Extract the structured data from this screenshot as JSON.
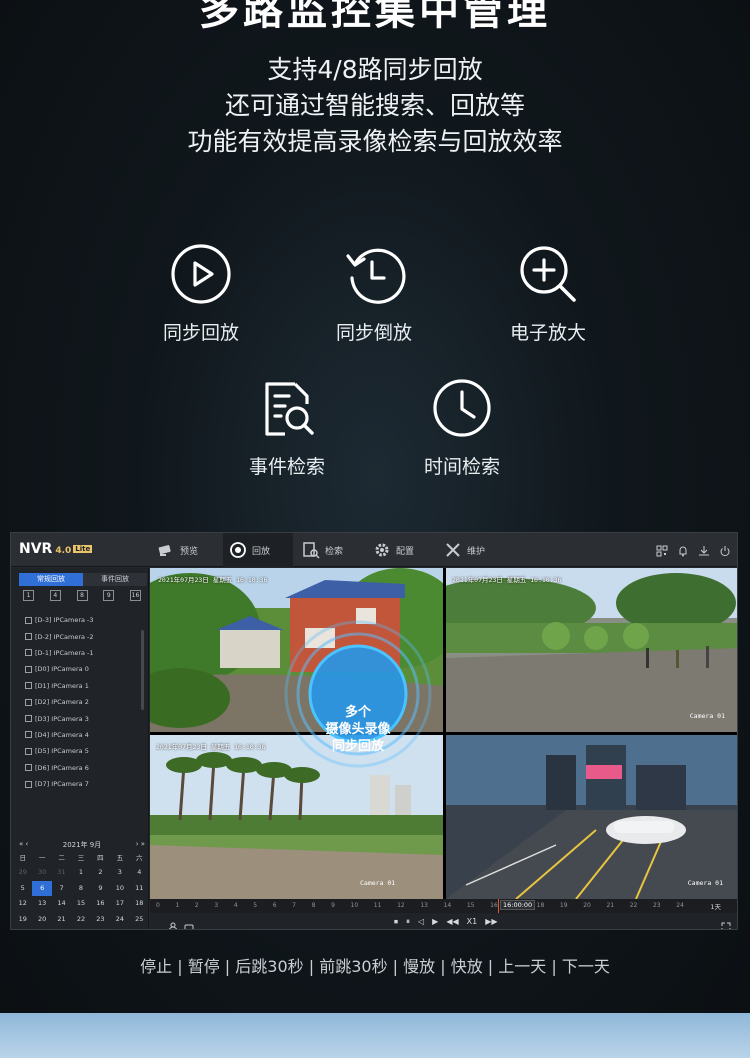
{
  "hero": {
    "headline": "多路监控集中管理",
    "desc_lines": [
      "支持4/8路同步回放",
      "还可通过智能搜索、回放等",
      "功能有效提高录像检索与回放效率"
    ]
  },
  "features": [
    {
      "label": "同步回放",
      "icon": "play-circle-icon"
    },
    {
      "label": "同步倒放",
      "icon": "rewind-clock-icon"
    },
    {
      "label": "电子放大",
      "icon": "zoom-in-icon"
    },
    {
      "label": "事件检索",
      "icon": "document-search-icon"
    },
    {
      "label": "时间检索",
      "icon": "clock-icon"
    }
  ],
  "nvr": {
    "logo": "NVR",
    "version": "4.0",
    "edition": "Lite",
    "nav": [
      {
        "label": "预览",
        "icon": "camera-icon"
      },
      {
        "label": "回放",
        "icon": "playback-icon"
      },
      {
        "label": "检索",
        "icon": "search-doc-icon"
      },
      {
        "label": "配置",
        "icon": "gear-icon"
      },
      {
        "label": "维护",
        "icon": "tools-icon"
      }
    ],
    "active_nav": "回放",
    "sidebar_tabs": [
      "常规回放",
      "事件回放"
    ],
    "layouts": [
      "1",
      "4",
      "8",
      "9",
      "16"
    ],
    "cameras": [
      "[D-3] IPCamera -3",
      "[D-2] IPCamera -2",
      "[D-1] IPCamera -1",
      "[D0] IPCamera 0",
      "[D1] IPCamera 1",
      "[D2] IPCamera 2",
      "[D3] IPCamera 3",
      "[D4] IPCamera 4",
      "[D5] IPCamera 5",
      "[D6] IPCamera 6",
      "[D7] IPCamera 7"
    ],
    "calendar": {
      "month_label": "2021年 9月",
      "nav_left": "«  ‹",
      "nav_right": "›  »",
      "weekdays": [
        "日",
        "一",
        "二",
        "三",
        "四",
        "五",
        "六"
      ],
      "rows": [
        [
          "29",
          "30",
          "31",
          "1",
          "2",
          "3",
          "4"
        ],
        [
          "5",
          "6",
          "7",
          "8",
          "9",
          "10",
          "11"
        ],
        [
          "12",
          "13",
          "14",
          "15",
          "16",
          "17",
          "18"
        ],
        [
          "19",
          "20",
          "21",
          "22",
          "23",
          "24",
          "25"
        ],
        [
          "26",
          "27",
          "28",
          "29",
          "30",
          "1",
          "2"
        ],
        [
          "3",
          "4",
          "5",
          "6",
          "7",
          "8",
          "9"
        ]
      ],
      "selected": "6"
    },
    "video": {
      "ts_top_left": "2021年07月23日 星期五 16:10:36",
      "ts_top_right": "2021年07月23日 星期五 16:10:36",
      "ts_bottom_left": "2021年07月23日 星期五 16:10:36",
      "cam_top_right": "Camera 01",
      "cam_bottom_left": "Camera 01",
      "cam_bottom_right": "Camera 01",
      "overlay_lines": [
        "多个",
        "摄像头录像",
        "同步回放"
      ]
    },
    "timeline": {
      "hours": [
        "0",
        "1",
        "2",
        "3",
        "4",
        "5",
        "6",
        "7",
        "8",
        "9",
        "10",
        "11",
        "12",
        "13",
        "14",
        "15",
        "16",
        "17",
        "18",
        "19",
        "20",
        "21",
        "22",
        "23",
        "24"
      ],
      "current_time": "16:00:00",
      "duration": "1天"
    },
    "controls": [
      "⏹",
      "⏸",
      "◁",
      "▶",
      "◀◀",
      "X1",
      "▶▶"
    ]
  },
  "controls_caption": "停止 | 暂停 | 后跳30秒 | 前跳30秒 | 慢放 | 快放 | 上一天 | 下一天"
}
